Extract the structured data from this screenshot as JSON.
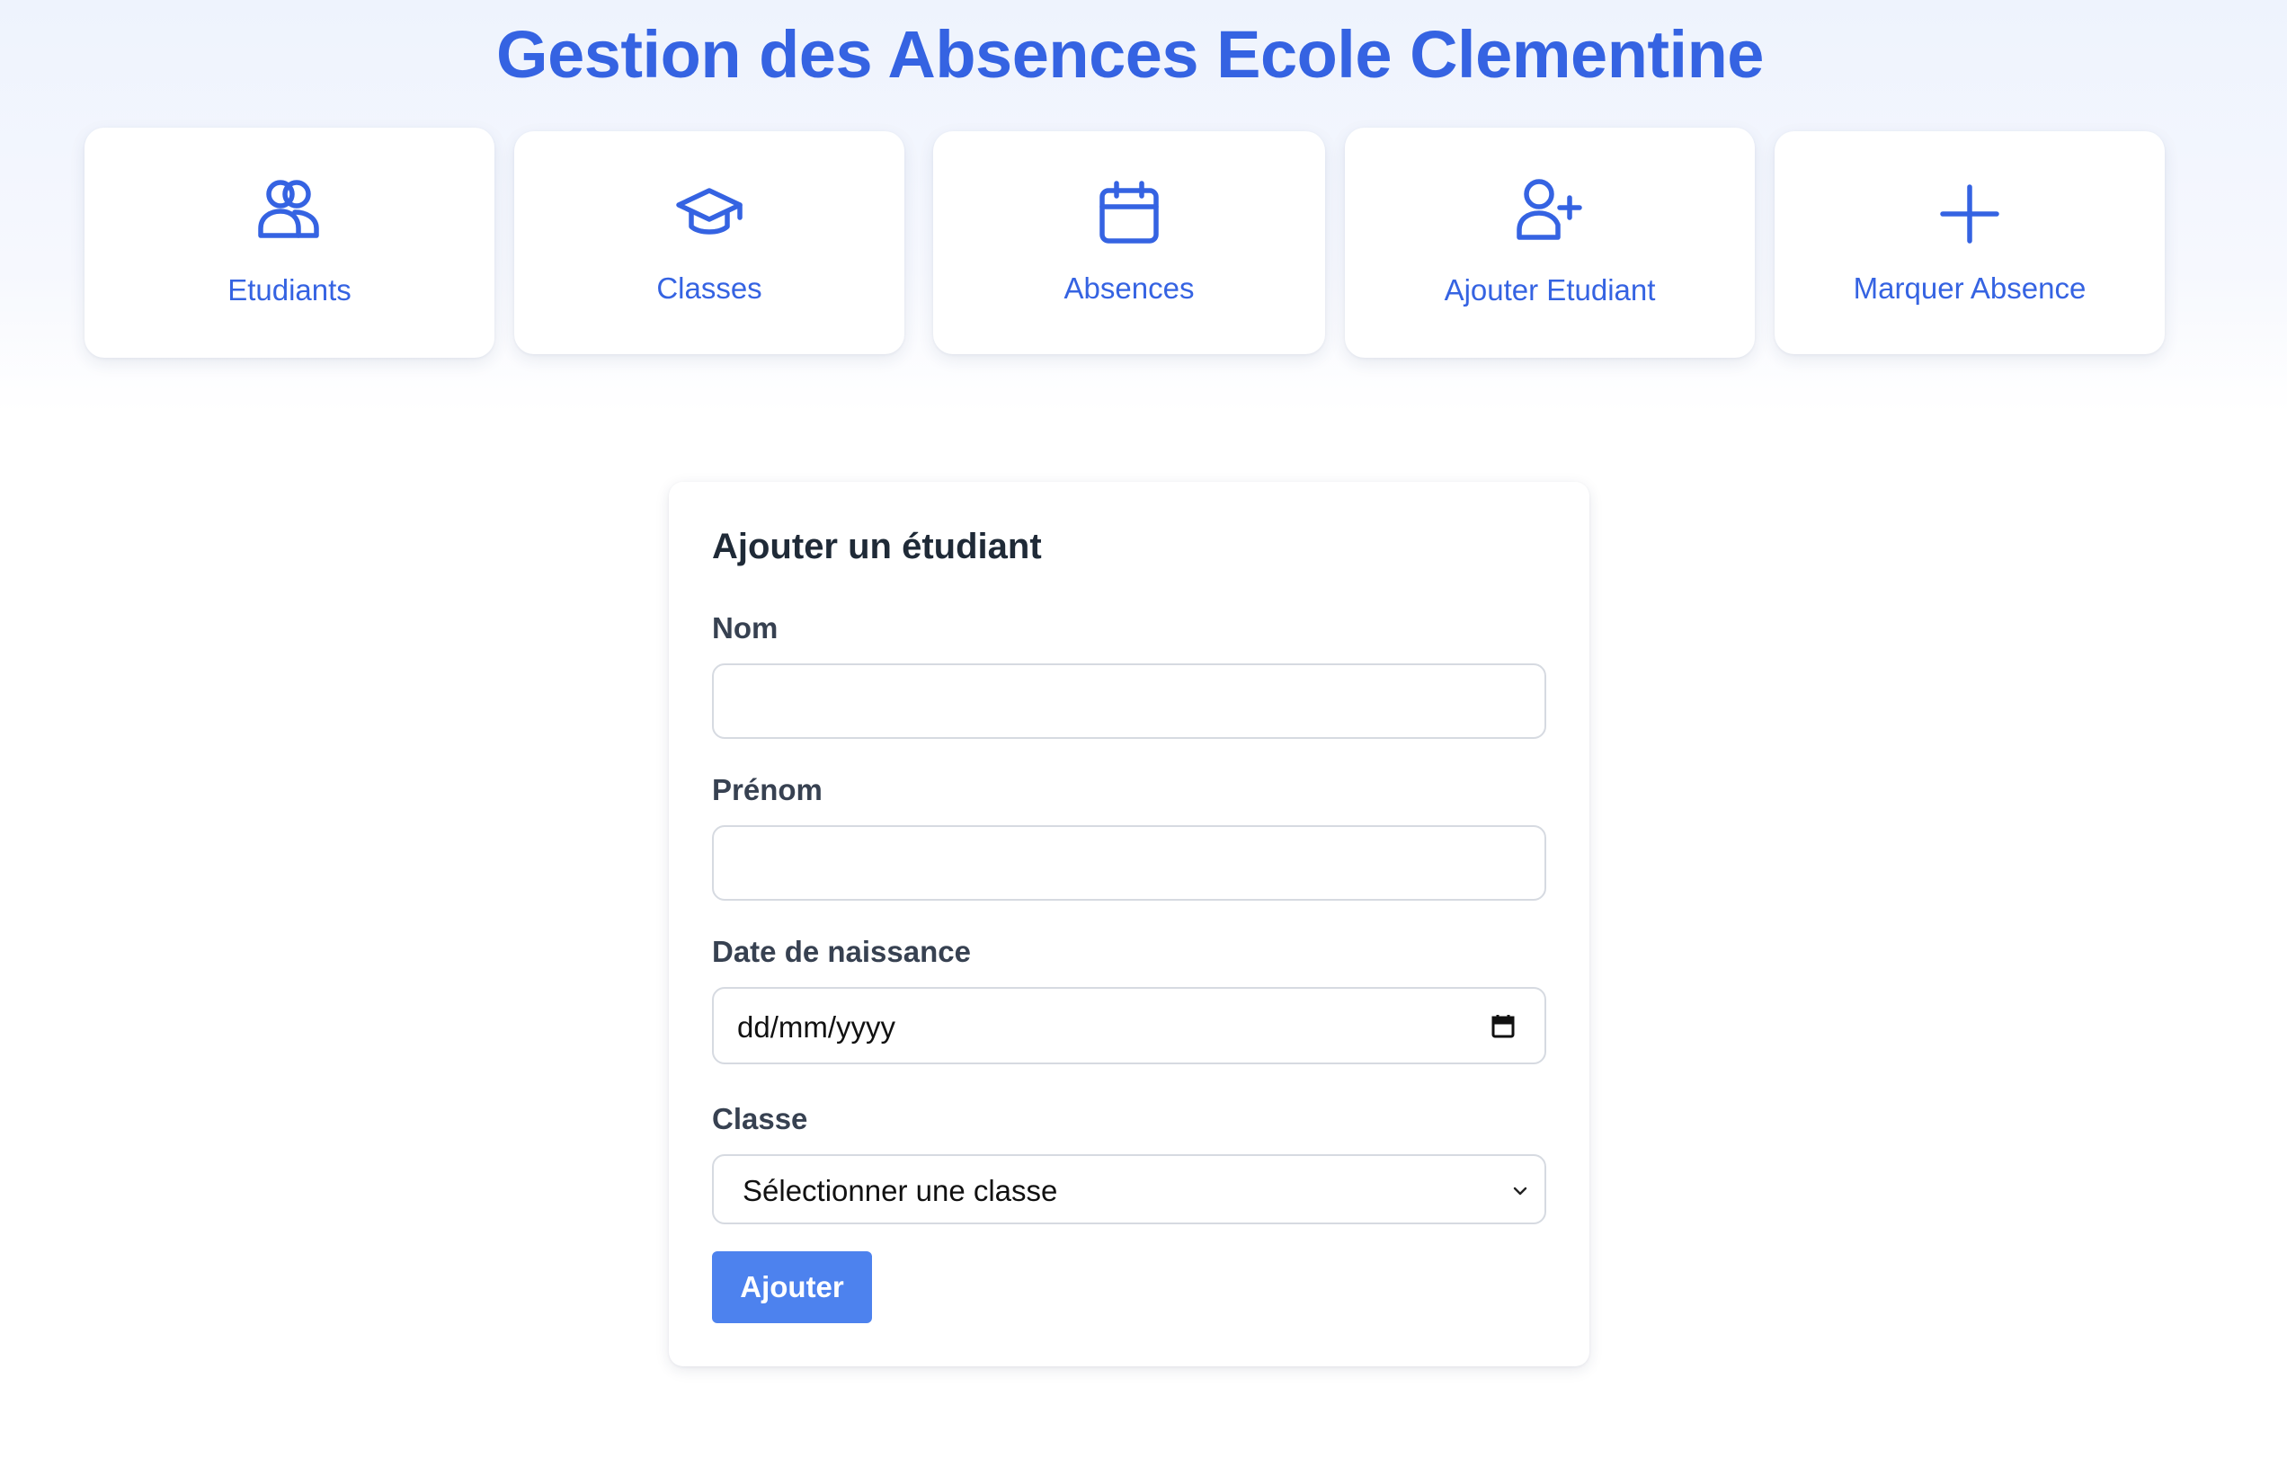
{
  "header": {
    "title": "Gestion des Absences Ecole Clementine"
  },
  "nav": {
    "items": [
      {
        "label": "Etudiants",
        "icon": "users-icon"
      },
      {
        "label": "Classes",
        "icon": "graduation-cap-icon"
      },
      {
        "label": "Absences",
        "icon": "calendar-icon"
      },
      {
        "label": "Ajouter Etudiant",
        "icon": "user-plus-icon"
      },
      {
        "label": "Marquer Absence",
        "icon": "plus-icon"
      }
    ]
  },
  "form": {
    "title": "Ajouter un étudiant",
    "fields": {
      "nom": {
        "label": "Nom",
        "value": "",
        "placeholder": ""
      },
      "prenom": {
        "label": "Prénom",
        "value": "",
        "placeholder": ""
      },
      "date_naissance": {
        "label": "Date de naissance",
        "value": "dd/mm/yyyy",
        "icon": "calendar-icon"
      },
      "classe": {
        "label": "Classe",
        "selected": "Sélectionner une classe",
        "icon": "chevron-down-icon"
      }
    },
    "submit_label": "Ajouter"
  },
  "colors": {
    "accent": "#3563e2",
    "button": "#4d82ee",
    "heading": "#1f2a37",
    "label": "#374151",
    "border": "#d6dae1"
  }
}
